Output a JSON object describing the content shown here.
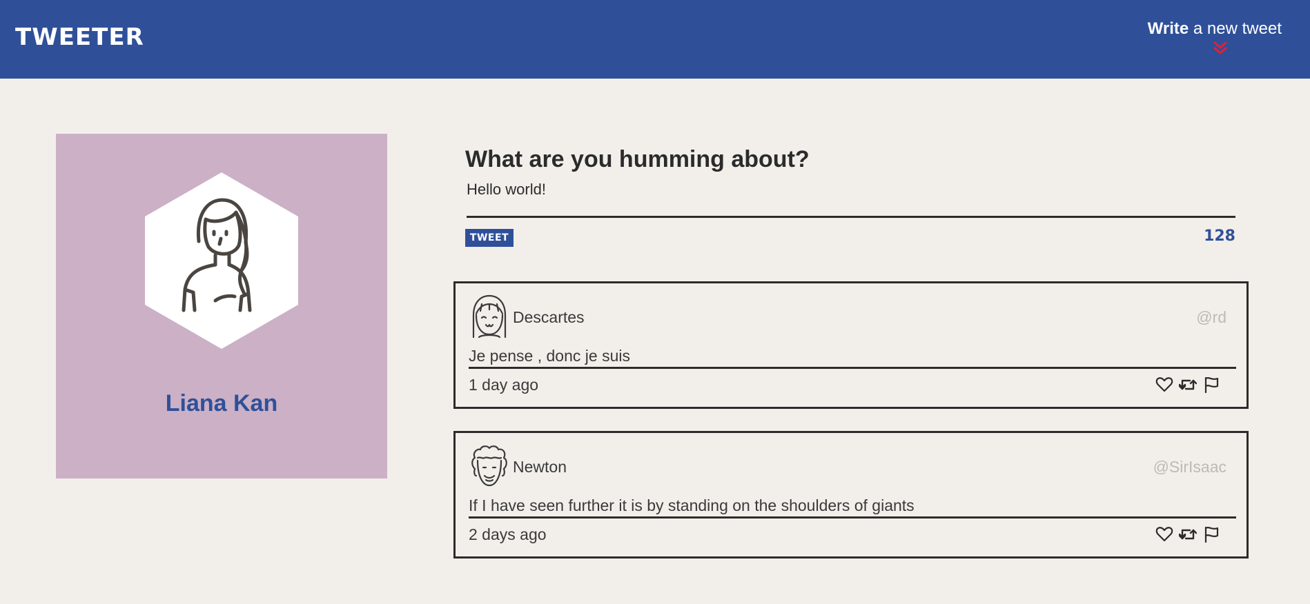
{
  "header": {
    "logo": "TWEETER",
    "compose_link_bold": "Write",
    "compose_link_rest": " a new tweet",
    "brand_color": "#2f5099",
    "accent_color": "#e0203a"
  },
  "profile": {
    "name": "Liana Kan",
    "card_color": "#cbb0c6",
    "avatar_icon": "woman-avatar-icon"
  },
  "compose": {
    "title": "What are you humming about?",
    "value": "Hello world!",
    "button_label": "TWEET",
    "counter": "128"
  },
  "tweets": [
    {
      "author": "Descartes",
      "handle": "@rd",
      "body": "Je pense , donc je suis",
      "time": "1 day ago",
      "avatar_icon": "girl-avatar-icon"
    },
    {
      "author": "Newton",
      "handle": "@SirIsaac",
      "body": "If I have seen further it is by standing on the shoulders of giants",
      "time": "2 days ago",
      "avatar_icon": "curly-hair-avatar-icon"
    }
  ]
}
